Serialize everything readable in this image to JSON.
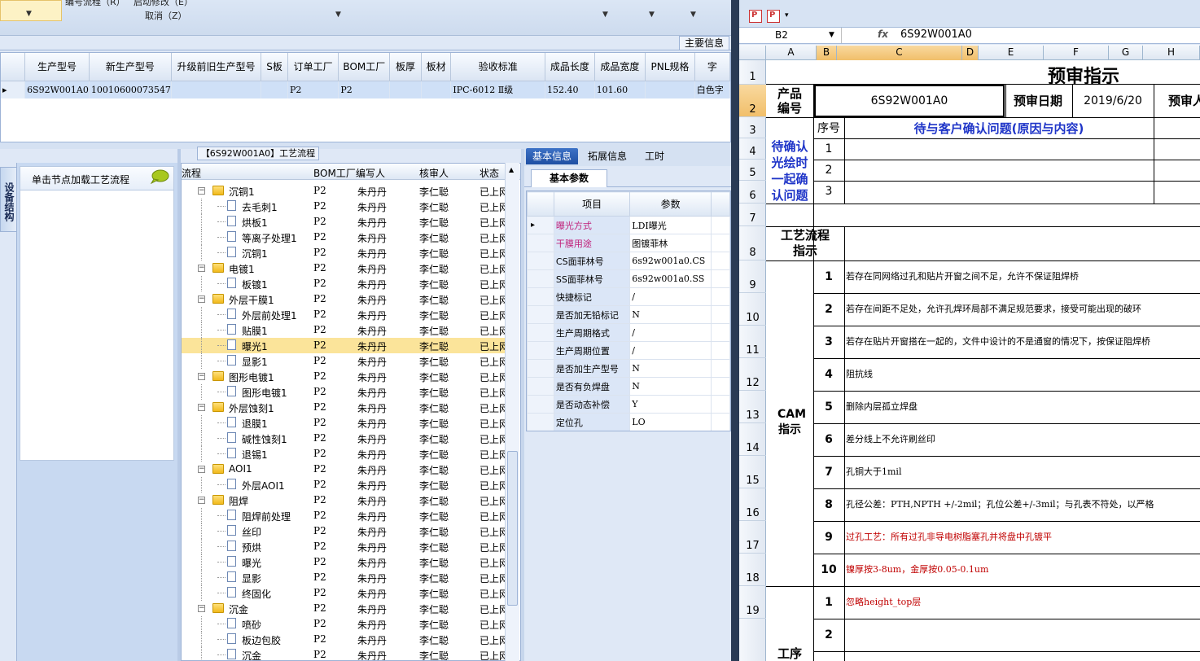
{
  "menu": {
    "item1": "编号流程（R）",
    "item2": "启动修改（E）",
    "item3": "取消（Z）"
  },
  "main_info_tab": "主要信息",
  "product_grid": {
    "columns": [
      "生产型号",
      "新生产型号",
      "升级前旧生产型号",
      "S板",
      "订单工厂",
      "BOM工厂",
      "板厚",
      "板材",
      "验收标准",
      "成品长度",
      "成品宽度",
      "PNL规格",
      "字"
    ],
    "row": [
      "6S92W001A0",
      "10010600073547",
      "",
      "",
      "P2",
      "P2",
      "",
      "",
      "IPC-6012 Ⅱ级",
      "152.40",
      "101.60",
      "",
      "白色字"
    ]
  },
  "side_tab": "设备结构",
  "left_panel": {
    "header": "单击节点加载工艺流程"
  },
  "process_tree": {
    "title": "【6S92W001A0】工艺流程",
    "columns": [
      "流程",
      "BOM工厂",
      "编写人",
      "核审人",
      "状态"
    ],
    "rows": [
      {
        "name": "沉铜1",
        "type": "folder",
        "bom": "P2",
        "writer": "朱丹丹",
        "reviewer": "李仁聪",
        "status": "已上网"
      },
      {
        "name": "去毛刺1",
        "type": "doc",
        "bom": "P2",
        "writer": "朱丹丹",
        "reviewer": "李仁聪",
        "status": "已上网"
      },
      {
        "name": "烘板1",
        "type": "doc",
        "bom": "P2",
        "writer": "朱丹丹",
        "reviewer": "李仁聪",
        "status": "已上网"
      },
      {
        "name": "等离子处理1",
        "type": "doc",
        "bom": "P2",
        "writer": "朱丹丹",
        "reviewer": "李仁聪",
        "status": "已上网"
      },
      {
        "name": "沉铜1",
        "type": "doc",
        "bom": "P2",
        "writer": "朱丹丹",
        "reviewer": "李仁聪",
        "status": "已上网"
      },
      {
        "name": "电镀1",
        "type": "folder",
        "bom": "P2",
        "writer": "朱丹丹",
        "reviewer": "李仁聪",
        "status": "已上网"
      },
      {
        "name": "板镀1",
        "type": "doc",
        "bom": "P2",
        "writer": "朱丹丹",
        "reviewer": "李仁聪",
        "status": "已上网"
      },
      {
        "name": "外层干膜1",
        "type": "folder",
        "bom": "P2",
        "writer": "朱丹丹",
        "reviewer": "李仁聪",
        "status": "已上网"
      },
      {
        "name": "外层前处理1",
        "type": "doc",
        "bom": "P2",
        "writer": "朱丹丹",
        "reviewer": "李仁聪",
        "status": "已上网"
      },
      {
        "name": "贴膜1",
        "type": "doc",
        "bom": "P2",
        "writer": "朱丹丹",
        "reviewer": "李仁聪",
        "status": "已上网"
      },
      {
        "name": "曝光1",
        "type": "doc",
        "bom": "P2",
        "writer": "朱丹丹",
        "reviewer": "李仁聪",
        "status": "已上网",
        "selected": true
      },
      {
        "name": "显影1",
        "type": "doc",
        "bom": "P2",
        "writer": "朱丹丹",
        "reviewer": "李仁聪",
        "status": "已上网"
      },
      {
        "name": "图形电镀1",
        "type": "folder",
        "bom": "P2",
        "writer": "朱丹丹",
        "reviewer": "李仁聪",
        "status": "已上网"
      },
      {
        "name": "图形电镀1",
        "type": "doc",
        "bom": "P2",
        "writer": "朱丹丹",
        "reviewer": "李仁聪",
        "status": "已上网"
      },
      {
        "name": "外层蚀刻1",
        "type": "folder",
        "bom": "P2",
        "writer": "朱丹丹",
        "reviewer": "李仁聪",
        "status": "已上网"
      },
      {
        "name": "退膜1",
        "type": "doc",
        "bom": "P2",
        "writer": "朱丹丹",
        "reviewer": "李仁聪",
        "status": "已上网"
      },
      {
        "name": "碱性蚀刻1",
        "type": "doc",
        "bom": "P2",
        "writer": "朱丹丹",
        "reviewer": "李仁聪",
        "status": "已上网"
      },
      {
        "name": "退锡1",
        "type": "doc",
        "bom": "P2",
        "writer": "朱丹丹",
        "reviewer": "李仁聪",
        "status": "已上网"
      },
      {
        "name": "AOI1",
        "type": "folder",
        "bom": "P2",
        "writer": "朱丹丹",
        "reviewer": "李仁聪",
        "status": "已上网"
      },
      {
        "name": "外层AOI1",
        "type": "doc",
        "bom": "P2",
        "writer": "朱丹丹",
        "reviewer": "李仁聪",
        "status": "已上网"
      },
      {
        "name": "阻焊",
        "type": "folder",
        "bom": "P2",
        "writer": "朱丹丹",
        "reviewer": "李仁聪",
        "status": "已上网"
      },
      {
        "name": "阻焊前处理",
        "type": "doc",
        "bom": "P2",
        "writer": "朱丹丹",
        "reviewer": "李仁聪",
        "status": "已上网"
      },
      {
        "name": "丝印",
        "type": "doc",
        "bom": "P2",
        "writer": "朱丹丹",
        "reviewer": "李仁聪",
        "status": "已上网"
      },
      {
        "name": "预烘",
        "type": "doc",
        "bom": "P2",
        "writer": "朱丹丹",
        "reviewer": "李仁聪",
        "status": "已上网"
      },
      {
        "name": "曝光",
        "type": "doc",
        "bom": "P2",
        "writer": "朱丹丹",
        "reviewer": "李仁聪",
        "status": "已上网"
      },
      {
        "name": "显影",
        "type": "doc",
        "bom": "P2",
        "writer": "朱丹丹",
        "reviewer": "李仁聪",
        "status": "已上网"
      },
      {
        "name": "终固化",
        "type": "doc",
        "bom": "P2",
        "writer": "朱丹丹",
        "reviewer": "李仁聪",
        "status": "已上网"
      },
      {
        "name": "沉金",
        "type": "folder",
        "bom": "P2",
        "writer": "朱丹丹",
        "reviewer": "李仁聪",
        "status": "已上网"
      },
      {
        "name": "喷砂",
        "type": "doc",
        "bom": "P2",
        "writer": "朱丹丹",
        "reviewer": "李仁聪",
        "status": "已上网"
      },
      {
        "name": "板边包胶",
        "type": "doc",
        "bom": "P2",
        "writer": "朱丹丹",
        "reviewer": "李仁聪",
        "status": "已上网"
      },
      {
        "name": "沉金",
        "type": "doc",
        "bom": "P2",
        "writer": "朱丹丹",
        "reviewer": "李仁聪",
        "status": "已上网"
      }
    ]
  },
  "right_panel": {
    "tabs": [
      "基本信息",
      "拓展信息",
      "工时"
    ],
    "subtab": "基本参数",
    "columns": [
      "项目",
      "参数"
    ],
    "params": [
      {
        "label": "曝光方式",
        "value": "LDI曝光",
        "pink": true
      },
      {
        "label": "干膜用途",
        "value": "图镀菲林",
        "pink": true
      },
      {
        "label": "CS面菲林号",
        "value": "6s92w001a0.CS"
      },
      {
        "label": "SS面菲林号",
        "value": "6s92w001a0.SS"
      },
      {
        "label": "快捷标记",
        "value": "/"
      },
      {
        "label": "是否加无铅标记",
        "value": "N"
      },
      {
        "label": "生产周期格式",
        "value": "/"
      },
      {
        "label": "生产周期位置",
        "value": "/"
      },
      {
        "label": "是否加生产型号",
        "value": "N"
      },
      {
        "label": "是否有负焊盘",
        "value": "N"
      },
      {
        "label": "是否动态补偿",
        "value": "Y"
      },
      {
        "label": "定位孔",
        "value": "LO"
      }
    ]
  },
  "excel": {
    "name_box": "B2",
    "fx": "fx",
    "formula": "6S92W001A0",
    "columns": [
      "A",
      "B",
      "C",
      "D",
      "E",
      "F",
      "G",
      "H"
    ],
    "rows": [
      "1",
      "2",
      "3",
      "4",
      "5",
      "6",
      "7",
      "8",
      "9",
      "10",
      "11",
      "12",
      "13",
      "14",
      "15",
      "16",
      "17",
      "18",
      "19"
    ],
    "sheet": {
      "title": "预审指示",
      "product_label": "产品编号",
      "product_value": "6S92W001A0",
      "date_label": "预审日期",
      "date_value": "2019/6/20",
      "reviewer_label": "预审人",
      "confirm_label": "待确认光绘时一起确认问题",
      "seq_label": "序号",
      "issue_header": "待与客户确认问题(原因与内容)",
      "confirm_nums": [
        "1",
        "2",
        "3"
      ],
      "process_label": "工艺流程指示",
      "cam_label": "CAM指示",
      "cam_items": [
        {
          "n": "1",
          "text": "若存在同网络过孔和贴片开窗之间不足，允许不保证阻焊桥"
        },
        {
          "n": "2",
          "text": "若存在间距不足处，允许孔焊环局部不满足规范要求，接受可能出现的破环"
        },
        {
          "n": "3",
          "text": "若存在贴片开窗搭在一起的，文件中设计的不是通窗的情况下，按保证阻焊桥"
        },
        {
          "n": "4",
          "text": "阻抗线"
        },
        {
          "n": "5",
          "text": "删除内层孤立焊盘"
        },
        {
          "n": "6",
          "text": "差分线上不允许刷丝印"
        },
        {
          "n": "7",
          "text": "孔铜大于1mil"
        },
        {
          "n": "8",
          "text": "孔径公差：PTH,NPTH +/-2mil；孔位公差+/-3mil；与孔表不符处，以严格"
        },
        {
          "n": "9",
          "text": "过孔工艺：所有过孔非导电树脂塞孔并将盘中孔镀平",
          "red": true
        },
        {
          "n": "10",
          "text": "镍厚按3-8um，金厚按0.05-0.1um",
          "red": true
        }
      ],
      "step_label": "工序",
      "step_items": [
        {
          "n": "1",
          "text": "忽略height_top层",
          "red": true
        },
        {
          "n": "2",
          "text": ""
        },
        {
          "n": "3",
          "text": ""
        }
      ]
    }
  },
  "colors": {
    "selection_yellow": "#fbe49a",
    "grid_row_blue": "#cfe0f7",
    "excel_blue_text": "#1f35c8",
    "excel_red_text": "#c00000",
    "param_pink": "#c0207a"
  }
}
